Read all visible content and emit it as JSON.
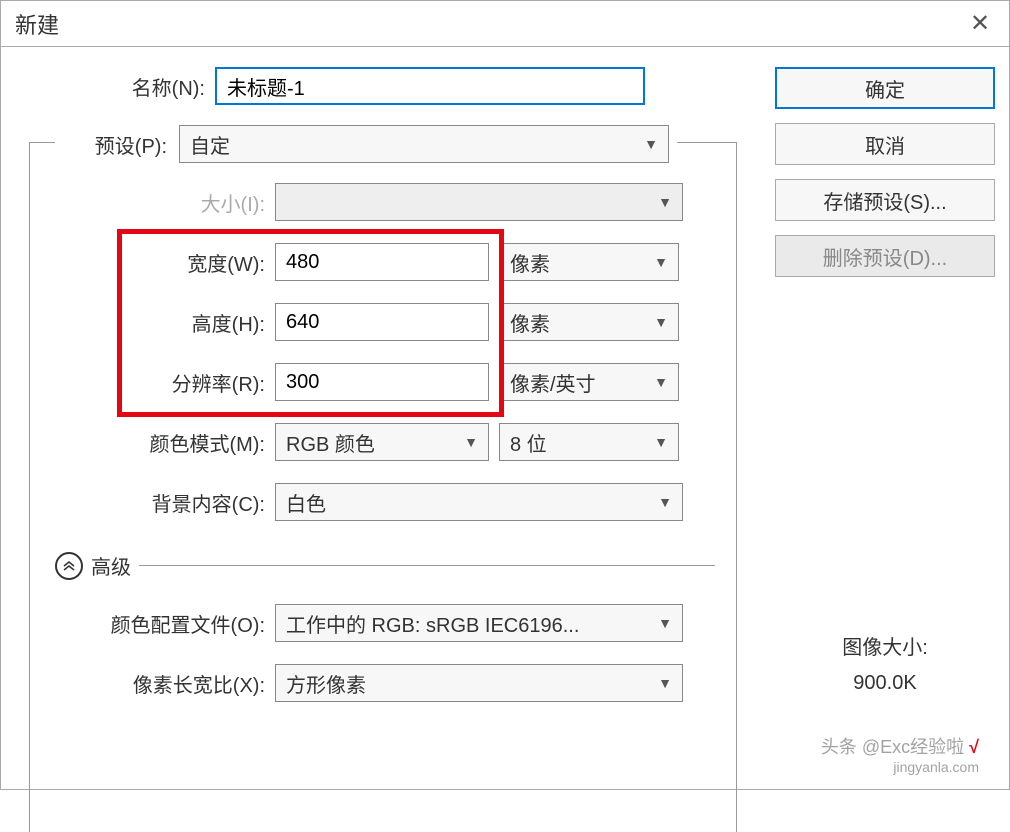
{
  "dialog": {
    "title": "新建"
  },
  "buttons": {
    "ok": "确定",
    "cancel": "取消",
    "save_preset": "存储预设(S)...",
    "delete_preset": "删除预设(D)..."
  },
  "labels": {
    "name": "名称(N):",
    "preset": "预设(P):",
    "size": "大小(I):",
    "width": "宽度(W):",
    "height": "高度(H):",
    "resolution": "分辨率(R):",
    "color_mode": "颜色模式(M):",
    "background": "背景内容(C):",
    "advanced": "高级",
    "color_profile": "颜色配置文件(O):",
    "pixel_ratio": "像素长宽比(X):",
    "image_size_label": "图像大小:",
    "image_size_value": "900.0K"
  },
  "values": {
    "name": "未标题-1",
    "preset": "自定",
    "size": "",
    "width": "480",
    "height": "640",
    "resolution": "300",
    "color_mode": "RGB 颜色",
    "color_depth": "8 位",
    "background": "白色",
    "color_profile": "工作中的 RGB: sRGB IEC6196...",
    "pixel_ratio": "方形像素"
  },
  "units": {
    "width": "像素",
    "height": "像素",
    "resolution": "像素/英寸"
  },
  "watermark": {
    "line1": "头条 @Exc经验啦",
    "line2": "jingyanla.com"
  }
}
